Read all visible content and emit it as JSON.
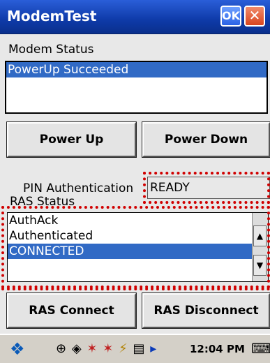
{
  "window": {
    "title": "ModemTest",
    "ok_label": "OK",
    "close_label": "✕"
  },
  "modem_status": {
    "label": "Modem Status",
    "items": [
      "PowerUp Succeeded"
    ],
    "selected_index": 0
  },
  "buttons": {
    "power_up": "Power Up",
    "power_down": "Power Down",
    "ras_connect": "RAS Connect",
    "ras_disconnect": "RAS Disconnect"
  },
  "pin": {
    "label": "PIN Authentication",
    "value": "READY"
  },
  "ras_status": {
    "label": "RAS Status",
    "items": [
      "AuthAck",
      "Authenticated",
      "CONNECTED"
    ],
    "selected_index": 2
  },
  "taskbar": {
    "clock": "12:04 PM",
    "tray_icons": [
      "network-icon",
      "sync-icon",
      "volume-icon",
      "power-icon",
      "battery-icon",
      "arrow-icon"
    ]
  },
  "colors": {
    "title_bar": "#0e3aa8",
    "selection": "#316ac5",
    "highlight_border": "#d00000"
  }
}
